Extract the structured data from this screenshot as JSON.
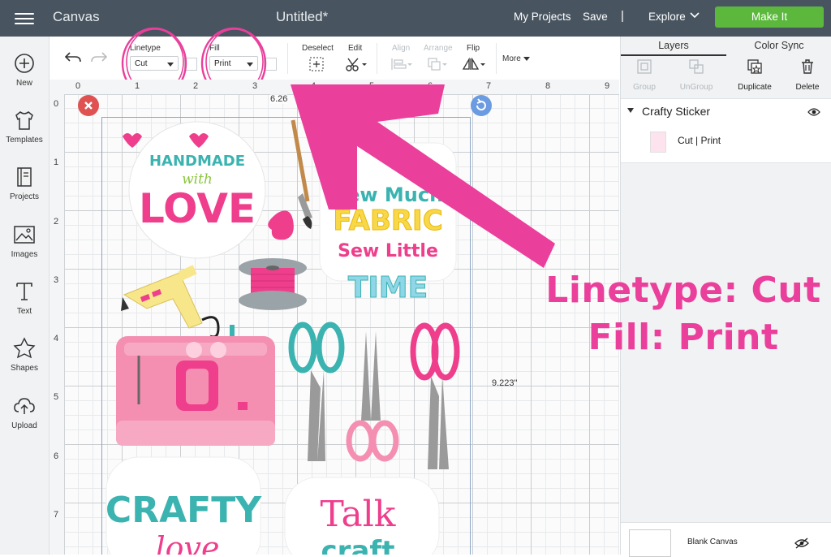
{
  "topbar": {
    "app_name": "Canvas",
    "doc_title": "Untitled*",
    "my_projects": "My Projects",
    "save": "Save",
    "separator": "|",
    "explore": "Explore",
    "make_it": "Make It"
  },
  "leftbar": {
    "items": [
      {
        "label": "New",
        "icon": "plus-circle-icon"
      },
      {
        "label": "Templates",
        "icon": "tshirt-icon"
      },
      {
        "label": "Projects",
        "icon": "book-icon"
      },
      {
        "label": "Images",
        "icon": "image-icon"
      },
      {
        "label": "Text",
        "icon": "text-T-icon"
      },
      {
        "label": "Shapes",
        "icon": "shapes-icon"
      },
      {
        "label": "Upload",
        "icon": "upload-cloud-icon"
      }
    ]
  },
  "toolbar": {
    "linetype_label": "Linetype",
    "linetype_value": "Cut",
    "fill_label": "Fill",
    "fill_value": "Print",
    "deselect_label": "Deselect",
    "edit_label": "Edit",
    "align_label": "Align",
    "arrange_label": "Arrange",
    "flip_label": "Flip",
    "more_label": "More"
  },
  "canvas": {
    "ruler_top": [
      "0",
      "1",
      "2",
      "3",
      "4",
      "5",
      "6",
      "7",
      "8",
      "9"
    ],
    "ruler_left": [
      "0",
      "1",
      "2",
      "3",
      "4",
      "5",
      "6",
      "7"
    ],
    "width_readout": "6.26",
    "height_readout": "9.223\""
  },
  "stickers": {
    "handmade_top": "HANDMADE",
    "handmade_mid": "with",
    "handmade_bottom": "LOVE",
    "sew_1": "Sew Much",
    "sew_2": "FABRIC",
    "sew_3": "Sew Little",
    "sew_4": "TIME",
    "crafty": "CRAFTY",
    "crafty_2": "love",
    "talk": "Talk",
    "talk_2": "craft"
  },
  "rightpanel": {
    "tab_layers": "Layers",
    "tab_color_sync": "Color Sync",
    "group": "Group",
    "ungroup": "UnGroup",
    "duplicate": "Duplicate",
    "delete": "Delete",
    "layer_name": "Crafty Sticker",
    "layer_detail": "Cut  | Print",
    "blank_canvas": "Blank Canvas"
  },
  "annotation": {
    "line1": "Linetype: Cut",
    "line2": "Fill: Print"
  },
  "colors": {
    "topbar": "#485560",
    "make_it": "#5cb83d",
    "annotation_pink": "#ea3f9b",
    "delete_red": "#e05252",
    "rotate_blue": "#6b9be0"
  }
}
